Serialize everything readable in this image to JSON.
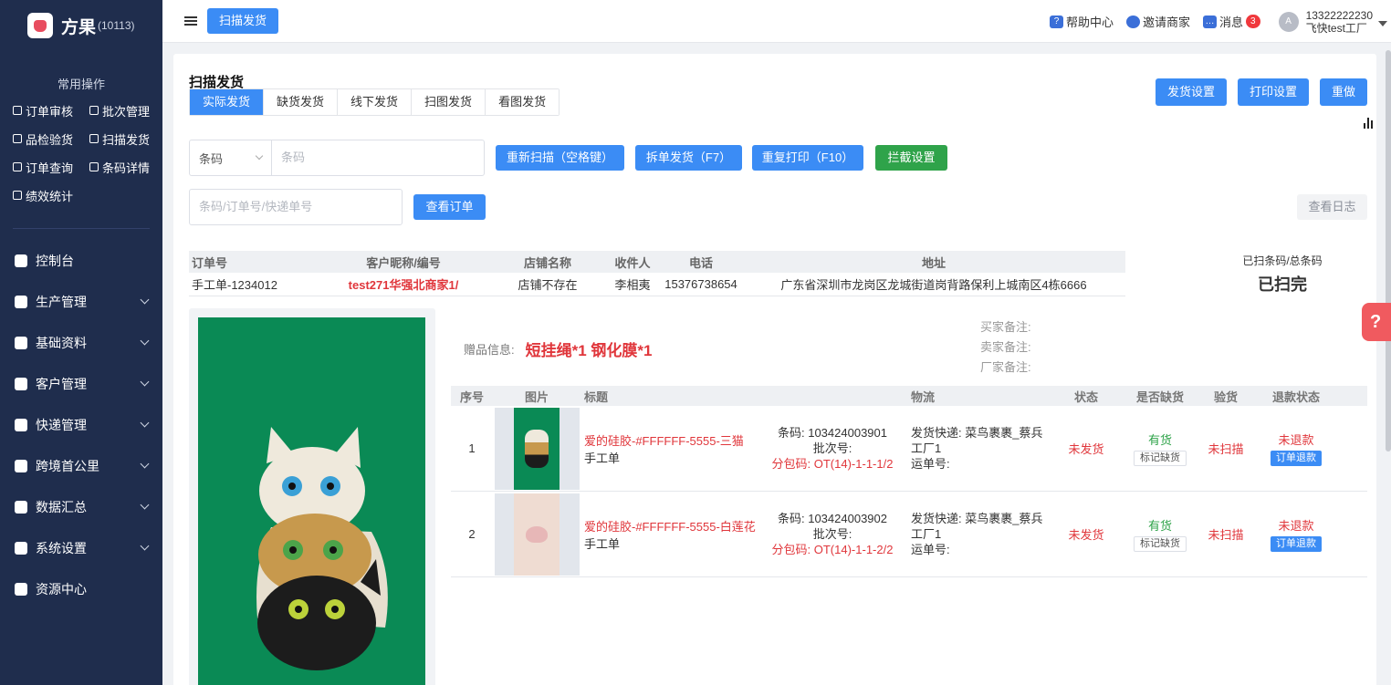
{
  "app": {
    "name": "方果",
    "code": "(10113)"
  },
  "sidebar": {
    "common_title": "常用操作",
    "quick": [
      {
        "label": "订单审核",
        "icon": "check-square-icon"
      },
      {
        "label": "批次管理",
        "icon": "batch-icon"
      },
      {
        "label": "品检验货",
        "icon": "inspect-icon"
      },
      {
        "label": "扫描发货",
        "icon": "scan-icon"
      },
      {
        "label": "订单查询",
        "icon": "search-doc-icon"
      },
      {
        "label": "条码详情",
        "icon": "barcode-icon"
      },
      {
        "label": "绩效统计",
        "icon": "stats-icon"
      }
    ],
    "menu": [
      {
        "label": "控制台",
        "icon": "dashboard-icon",
        "expandable": false
      },
      {
        "label": "生产管理",
        "icon": "production-icon",
        "expandable": true
      },
      {
        "label": "基础资料",
        "icon": "database-icon",
        "expandable": true
      },
      {
        "label": "客户管理",
        "icon": "user-icon",
        "expandable": true
      },
      {
        "label": "快递管理",
        "icon": "courier-icon",
        "expandable": true
      },
      {
        "label": "跨境首公里",
        "icon": "globe-icon",
        "expandable": true
      },
      {
        "label": "数据汇总",
        "icon": "pie-chart-icon",
        "expandable": true
      },
      {
        "label": "系统设置",
        "icon": "settings-icon",
        "expandable": true
      },
      {
        "label": "资源中心",
        "icon": "download-icon",
        "expandable": false
      }
    ]
  },
  "topbar": {
    "active_tab": "扫描发货",
    "help": "帮助中心",
    "invite": "邀请商家",
    "messages": "消息",
    "message_count": "3",
    "avatar_letter": "A",
    "phone": "13322222230",
    "company": "飞快test工厂"
  },
  "page": {
    "title": "扫描发货",
    "tabs": [
      "实际发货",
      "缺货发货",
      "线下发货",
      "扫图发货",
      "看图发货"
    ],
    "active_tab_index": 0,
    "buttons": {
      "ship_settings": "发货设置",
      "print_settings": "打印设置",
      "redo": "重做",
      "rescan": "重新扫描（空格键）",
      "split_ship": "拆单发货（F7）",
      "reprint": "重复打印（F10）",
      "intercept": "拦截设置",
      "view_order": "查看订单",
      "view_log": "查看日志"
    },
    "barcode_select": "条码",
    "barcode_placeholder": "条码",
    "order_search_placeholder": "条码/订单号/快递单号",
    "order_table": {
      "headers": [
        "订单号",
        "客户昵称/编号",
        "店铺名称",
        "收件人",
        "电话",
        "地址"
      ],
      "row": [
        "手工单-1234012",
        "test271华强北商家1/",
        "店铺不存在",
        "李相夷",
        "15376738654",
        "广东省深圳市龙岗区龙城街道岗背路保利上城南区4栋6666"
      ]
    },
    "scanned": {
      "label": "已扫条码/总条码",
      "value": "已扫完"
    },
    "gift": {
      "label": "赠品信息:",
      "value": "短挂绳*1  钢化膜*1"
    },
    "remarks": [
      "买家备注:",
      "卖家备注:",
      "厂家备注:"
    ],
    "items": {
      "headers": [
        "序号",
        "图片",
        "标题",
        "",
        "物流",
        "状态",
        "是否缺货",
        "验货",
        "退款状态"
      ],
      "rows": [
        {
          "no": "1",
          "title": "爱的硅胶-#FFFFFF-5555-三猫",
          "subtitle": "手工单",
          "barcode": "条码: 103424003901",
          "batch": "批次号:",
          "pack": "分包码: OT(14)-1-1-1/2",
          "courier": "发货快递: 菜鸟裹裹_蔡兵",
          "factory": "工厂1",
          "waybill": "运单号:",
          "status": "未发货",
          "stock": "有货",
          "mark_btn": "标记缺货",
          "inspect": "未扫描",
          "refund": "未退款",
          "refund_btn": "订单退款",
          "thumb_color": "#0a8a55"
        },
        {
          "no": "2",
          "title": "爱的硅胶-#FFFFFF-5555-白莲花",
          "subtitle": "手工单",
          "barcode": "条码: 103424003902",
          "batch": "批次号:",
          "pack": "分包码: OT(14)-1-1-2/2",
          "courier": "发货快递: 菜鸟裹裹_蔡兵",
          "factory": "工厂1",
          "waybill": "运单号:",
          "status": "未发货",
          "stock": "有货",
          "mark_btn": "标记缺货",
          "inspect": "未扫描",
          "refund": "未退款",
          "refund_btn": "订单退款",
          "thumb_color": "#efdcd2"
        }
      ]
    }
  }
}
